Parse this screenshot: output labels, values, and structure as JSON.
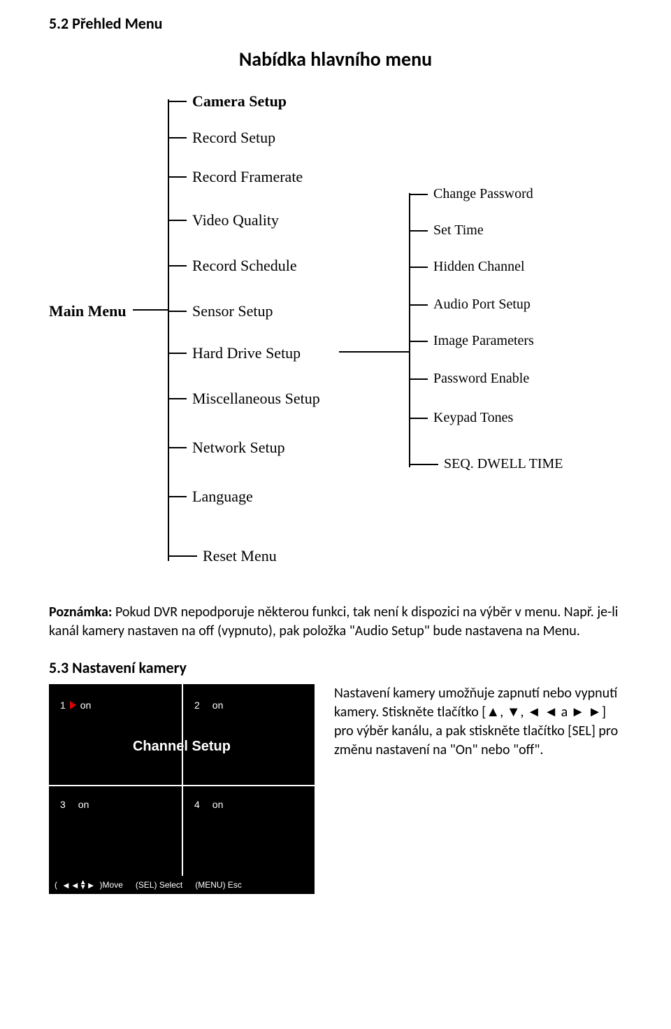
{
  "headings": {
    "section": "5.2 Přehled Menu",
    "title": "Nabídka hlavního menu",
    "camera_section": "5.3 Nastavení kamery"
  },
  "diagram": {
    "main_label": "Main Menu",
    "main_items": [
      "Camera    Setup",
      "Record Setup",
      "Record Framerate",
      "Video Quality",
      "Record Schedule",
      "Sensor Setup",
      "Hard Drive Setup",
      "Miscellaneous Setup",
      "Network Setup",
      "Language",
      "Reset Menu"
    ],
    "sub_items": [
      "Change Password",
      "Set Time",
      "Hidden Channel",
      "Audio Port Setup",
      "Image Parameters",
      "Password Enable",
      "Keypad Tones",
      "SEQ. DWELL TIME"
    ]
  },
  "note": {
    "label": "Poznámka:",
    "text": " Pokud DVR nepodporuje některou funkci, tak není k dispozici na výběr v menu. Např. je-li kanál kamery nastaven na off (vypnuto), pak položka \"Audio Setup\" bude nastavena na Menu."
  },
  "channel_box": {
    "title": "Channel Setup",
    "cells": [
      {
        "num": "1",
        "state": "on"
      },
      {
        "num": "2",
        "state": "on"
      },
      {
        "num": "3",
        "state": "on"
      },
      {
        "num": "4",
        "state": "on"
      }
    ],
    "footer": {
      "open": "(",
      "move": ")Move",
      "sel": "(SEL) Select",
      "esc": "(MENU) Esc"
    }
  },
  "camera_text": "Nastavení kamery umožňuje zapnutí nebo vypnutí kamery. Stiskněte tlačítko [▲, ▼, ◄ ◄ a ► ►] pro výběr kanálu, a pak stiskněte tlačítko [SEL] pro změnu nastavení na \"On\" nebo \"off\"."
}
